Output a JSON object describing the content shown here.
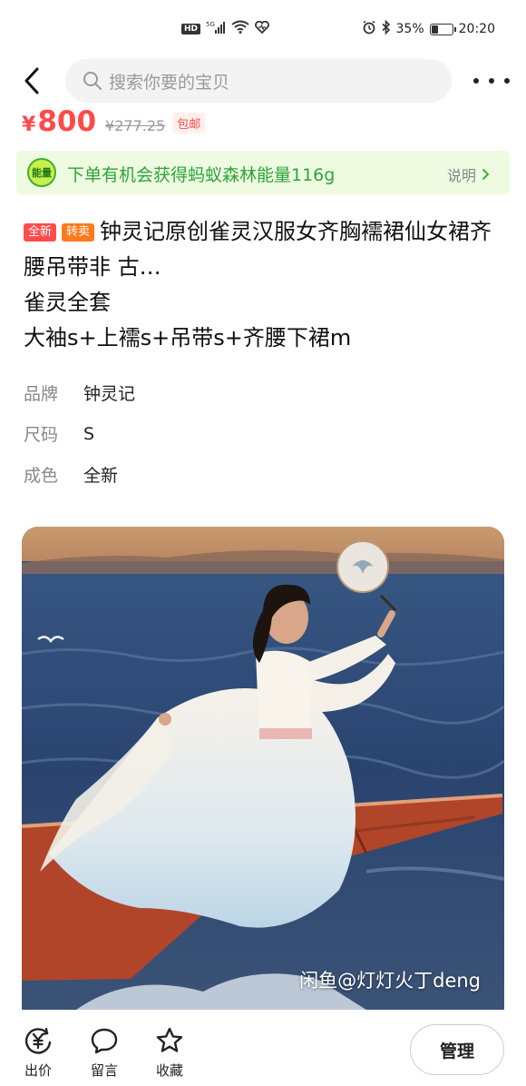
{
  "status_bar": {
    "network_badge": "HD",
    "signal": "5G",
    "battery_text": "35%",
    "battery_level": 0.35,
    "time": "20:20",
    "icons": [
      "hd-icon",
      "signal-icon",
      "wifi-icon",
      "heart-icon",
      "alarm-icon",
      "bluetooth-icon",
      "battery-icon"
    ]
  },
  "top_bar": {
    "back_icon": "chevron-left-icon",
    "search_placeholder": "搜索你要的宝贝",
    "more_icon": "more-dots-icon"
  },
  "price": {
    "currency": "¥",
    "amount": "800",
    "original": "¥277.25",
    "shipping_badge": "包邮"
  },
  "energy_banner": {
    "badge": "能量",
    "text": "下单有机会获得蚂蚁森林能量116g",
    "link": "说明"
  },
  "title": {
    "tags": [
      "全新",
      "转卖"
    ],
    "lines": [
      "钟灵记原创雀灵汉服女齐胸襦裙仙女裙齐腰吊带非 古…",
      "雀灵全套",
      "大袖s+上襦s+吊带s+齐腰下裙m"
    ]
  },
  "specs": [
    {
      "key": "品牌",
      "value": "钟灵记"
    },
    {
      "key": "尺码",
      "value": "S"
    },
    {
      "key": "成色",
      "value": "全新"
    }
  ],
  "photo": {
    "watermark": "闲鱼@灯灯火丁deng"
  },
  "bottom_bar": {
    "items": [
      {
        "label": "出价",
        "icon": "yuan-coin-icon"
      },
      {
        "label": "留言",
        "icon": "message-bubble-icon"
      },
      {
        "label": "收藏",
        "icon": "star-icon"
      }
    ],
    "manage_label": "管理"
  },
  "colors": {
    "price_red": "#ff4a4a",
    "energy_green": "#2ea53a",
    "energy_bg": "#eefbe1",
    "tag_new": "#ff4d4d",
    "tag_resell": "#ff7a1a"
  }
}
